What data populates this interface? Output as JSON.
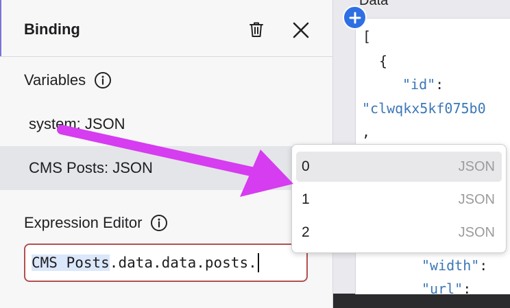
{
  "colors": {
    "accent": "#2f6fe4",
    "arrow": "#d63cf0",
    "error_border": "#b24f4f",
    "json_key": "#3b77b6"
  },
  "binding_panel": {
    "title": "Binding",
    "delete_icon": "trash-icon",
    "close_icon": "close-icon",
    "variables_label": "Variables",
    "variables": [
      {
        "label": "system: JSON",
        "selected": false
      },
      {
        "label": "CMS Posts: JSON",
        "selected": true
      }
    ],
    "expression_label": "Expression Editor",
    "expression": {
      "highlighted": "CMS Posts",
      "rest": ".data.data.posts."
    }
  },
  "suggestions": [
    {
      "label": "0",
      "type": "JSON",
      "active": true
    },
    {
      "label": "1",
      "type": "JSON",
      "active": false
    },
    {
      "label": "2",
      "type": "JSON",
      "active": false
    }
  ],
  "data_panel": {
    "title": "Data",
    "lines": {
      "l1": "[",
      "l2": "{",
      "l3_key": "\"id\"",
      "l3_punc": ":",
      "l4": "\"clwqkx5kf075b0",
      "l5": ",",
      "l6_key": "\"width\"",
      "l6_punc": ":",
      "l7_key": "\"url\"",
      "l7_punc": ":"
    }
  }
}
